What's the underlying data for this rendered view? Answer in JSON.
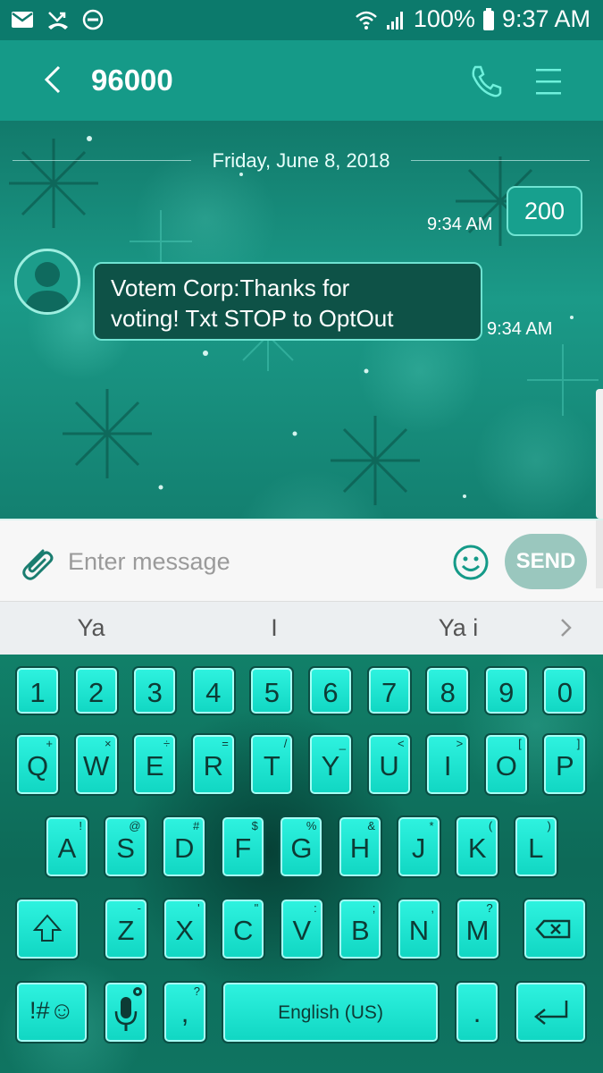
{
  "status_bar": {
    "left_icons": [
      "mail-icon",
      "missed-call-icon",
      "do-not-disturb-icon"
    ],
    "battery": "100%",
    "time": "9:37 AM"
  },
  "app_bar": {
    "title": "96000",
    "back_icon": "chevron-left-icon",
    "call_icon": "phone-icon",
    "menu_icon": "menu-icon"
  },
  "conversation": {
    "date": "Friday, June 8, 2018",
    "messages": [
      {
        "direction": "out",
        "text": "200",
        "time": "9:34 AM"
      },
      {
        "direction": "in",
        "text_line1": "Votem Corp:Thanks for",
        "text_line2": "voting! Txt STOP to OptOut",
        "time": "9:34 AM"
      }
    ]
  },
  "composer": {
    "placeholder": "Enter message",
    "send_label": "SEND"
  },
  "suggestions": {
    "items": [
      "Ya",
      "I",
      "Ya i"
    ]
  },
  "keyboard": {
    "number_row": [
      "1",
      "2",
      "3",
      "4",
      "5",
      "6",
      "7",
      "8",
      "9",
      "0"
    ],
    "row1": [
      {
        "key": "Q",
        "sub": "+"
      },
      {
        "key": "W",
        "sub": "×"
      },
      {
        "key": "E",
        "sub": "÷"
      },
      {
        "key": "R",
        "sub": "="
      },
      {
        "key": "T",
        "sub": "/"
      },
      {
        "key": "Y",
        "sub": "_"
      },
      {
        "key": "U",
        "sub": "<"
      },
      {
        "key": "I",
        "sub": ">"
      },
      {
        "key": "O",
        "sub": "["
      },
      {
        "key": "P",
        "sub": "]"
      }
    ],
    "row2": [
      {
        "key": "A",
        "sub": "!"
      },
      {
        "key": "S",
        "sub": "@"
      },
      {
        "key": "D",
        "sub": "#"
      },
      {
        "key": "F",
        "sub": "$"
      },
      {
        "key": "G",
        "sub": "%"
      },
      {
        "key": "H",
        "sub": "&"
      },
      {
        "key": "J",
        "sub": "*"
      },
      {
        "key": "K",
        "sub": "("
      },
      {
        "key": "L",
        "sub": ")"
      }
    ],
    "row3": [
      {
        "key": "Z",
        "sub": "-"
      },
      {
        "key": "X",
        "sub": "'"
      },
      {
        "key": "C",
        "sub": "\""
      },
      {
        "key": "V",
        "sub": ":"
      },
      {
        "key": "B",
        "sub": ";"
      },
      {
        "key": "N",
        "sub": ","
      },
      {
        "key": "M",
        "sub": "?"
      }
    ],
    "symbols_label": "!#☺",
    "comma_label": ",",
    "comma_sub": "?",
    "space_label": "English (US)",
    "period_label": "."
  },
  "colors": {
    "accent": "#159a88",
    "key_face": "#1fe6d2",
    "send_disabled": "#9ac7be"
  }
}
